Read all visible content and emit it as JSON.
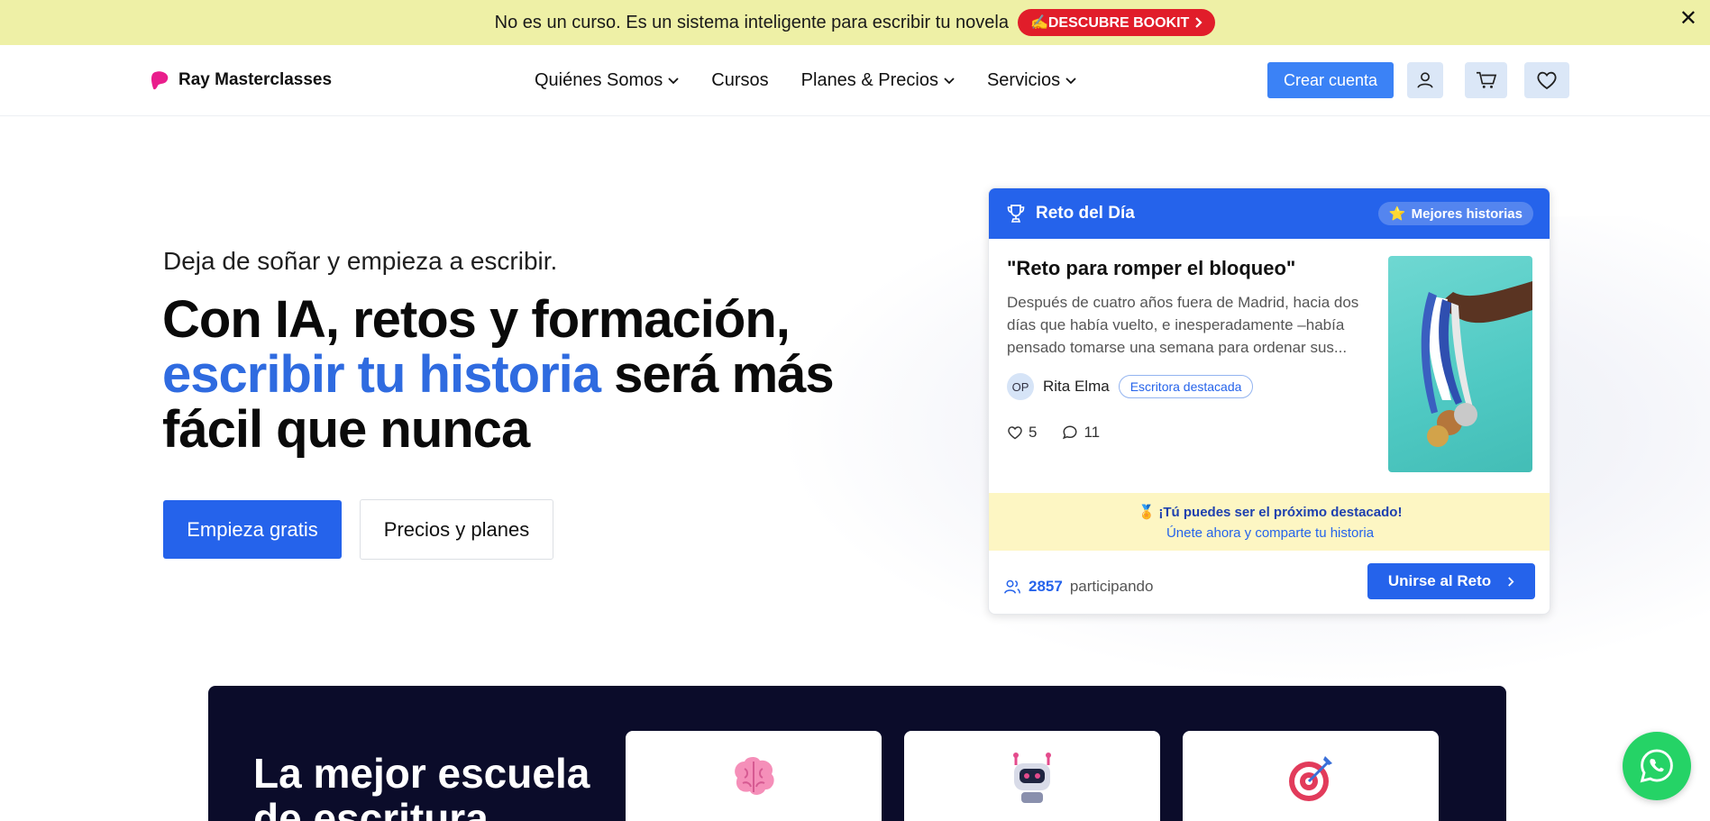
{
  "announcement": {
    "text": "No es un curso. Es un sistema inteligente para escribir tu novela",
    "button_label": "✍️DESCUBRE BOOKIT",
    "close_label": "✕"
  },
  "header": {
    "brand": "Ray Masterclasses",
    "nav": [
      {
        "label": "Quiénes Somos"
      },
      {
        "label": "Cursos"
      },
      {
        "label": "Planes & Precios"
      },
      {
        "label": "Servicios"
      }
    ],
    "create_account": "Crear cuenta"
  },
  "hero": {
    "subtitle": "Deja de soñar y empieza a escribir.",
    "title_part1": "Con IA, retos y formación,",
    "title_highlight": "escribir tu historia",
    "title_part2": " será más fácil que nunca",
    "primary_cta": "Empieza gratis",
    "secondary_cta": "Precios y planes"
  },
  "challenge": {
    "header_title": "Reto del Día",
    "badge": "Mejores historias",
    "badge_icon": "⭐",
    "story_title": "\"Reto para romper el bloqueo\"",
    "excerpt": "Después de cuatro años fuera de Madrid, hacia dos días que había vuelto, e inesperadamente –había pensado tomarse una semana para ordenar sus...",
    "author_initials": "OP",
    "author_name": "Rita Elma",
    "author_tag": "Escritora destacada",
    "likes": "5",
    "comments": "11",
    "promo_line1": "🏅 ¡Tú puedes ser el próximo destacado!",
    "promo_line2": "Únete ahora y comparte tu historia",
    "participants_count": "2857",
    "participants_label": "participando",
    "join_label": "Unirse al Reto"
  },
  "school": {
    "title": "La mejor escuela de escritura",
    "features": [
      {
        "icon": "brain-icon"
      },
      {
        "icon": "robot-icon"
      },
      {
        "icon": "target-icon"
      }
    ]
  },
  "colors": {
    "accent": "#2563eb",
    "announcement_bg": "#eef0a6",
    "promo_red": "#e11d2a",
    "dark_section": "#0b0c2a",
    "whatsapp": "#25d366"
  }
}
